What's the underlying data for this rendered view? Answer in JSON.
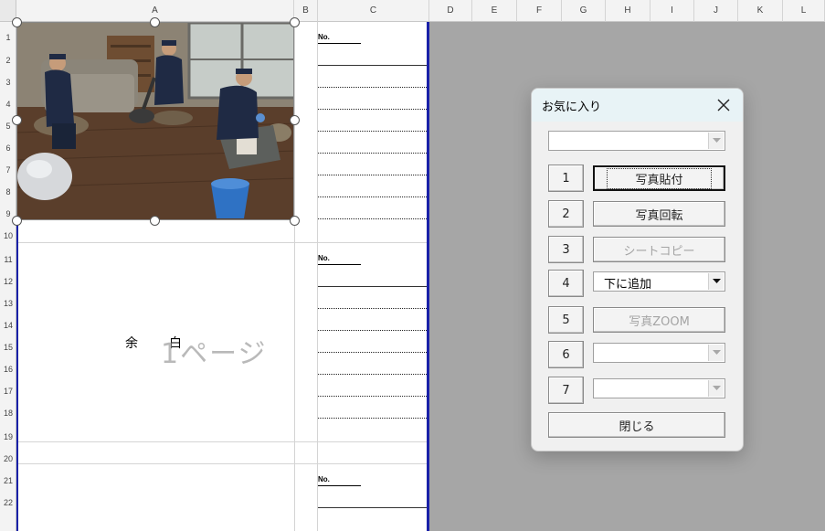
{
  "sheet": {
    "column_headers": [
      "A",
      "B",
      "C",
      "D",
      "E",
      "F",
      "G",
      "H",
      "I",
      "J",
      "K",
      "L"
    ],
    "row_headers": [
      "1",
      "2",
      "3",
      "4",
      "5",
      "6",
      "7",
      "8",
      "9",
      "10",
      "11",
      "12",
      "13",
      "14",
      "15",
      "16",
      "17",
      "18",
      "19",
      "20",
      "21",
      "22"
    ],
    "no_label": "No.",
    "margin_chars": [
      "余",
      "白"
    ],
    "page_text": "1ページ"
  },
  "dialog": {
    "title": "お気に入り",
    "close_icon": "close-icon",
    "top_combo_value": "",
    "rows": [
      {
        "num": "1",
        "label": "写真貼付",
        "kind": "button",
        "focused": true,
        "enabled": true
      },
      {
        "num": "2",
        "label": "写真回転",
        "kind": "button",
        "enabled": true
      },
      {
        "num": "3",
        "label": "シートコピー",
        "kind": "button",
        "enabled": false
      },
      {
        "num": "4",
        "label": "下に追加",
        "kind": "combo",
        "enabled": true
      },
      {
        "num": "5",
        "label": "写真ZOOM",
        "kind": "button",
        "enabled": false
      },
      {
        "num": "6",
        "label": "",
        "kind": "combo",
        "enabled": false
      },
      {
        "num": "7",
        "label": "",
        "kind": "combo",
        "enabled": false
      }
    ],
    "close_label": "閉じる"
  },
  "colors": {
    "page_border": "#1a21a8",
    "dialog_titlebar": "#e8f3f6",
    "sheet_background": "#a6a6a6"
  }
}
